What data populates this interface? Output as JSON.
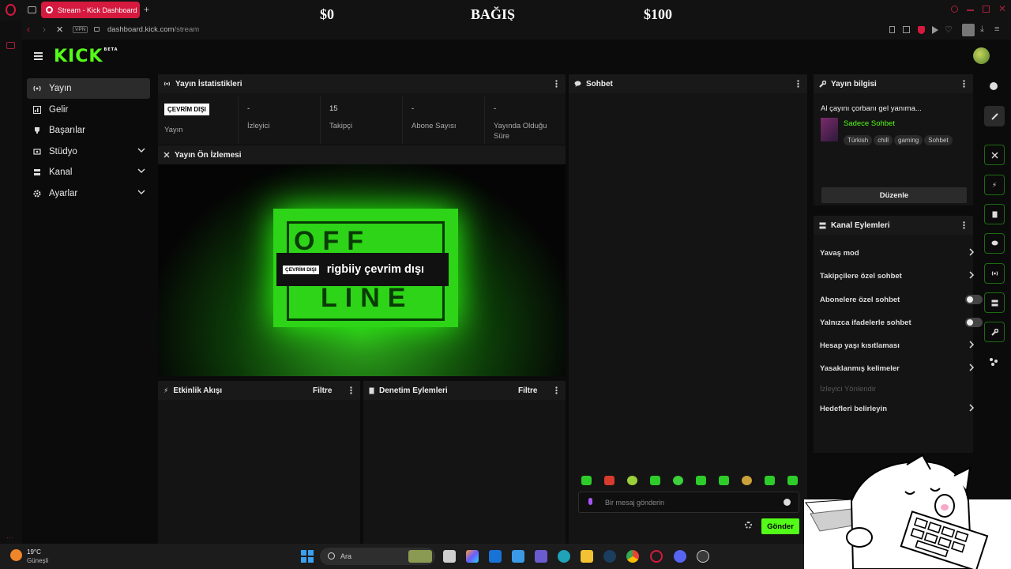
{
  "browser": {
    "tab_title": "Stream - Kick Dashboard",
    "url_host": "dashboard.kick.com",
    "url_path": "/stream",
    "vpn_label": "VPN"
  },
  "overlay": {
    "left_amount": "$0",
    "title": "BAĞIŞ",
    "right_amount": "$100"
  },
  "app": {
    "logo": "KICK",
    "logo_badge": "BETA"
  },
  "sidebar": {
    "items": [
      {
        "label": "Yayın"
      },
      {
        "label": "Gelir"
      },
      {
        "label": "Başarılar"
      },
      {
        "label": "Stüdyo"
      },
      {
        "label": "Kanal"
      },
      {
        "label": "Ayarlar"
      }
    ]
  },
  "stats_panel": {
    "title": "Yayın İstatistikleri",
    "status_badge": "ÇEVRİM DIŞI",
    "status_label": "Yayın",
    "stats": [
      {
        "value": "-",
        "label": "İzleyici"
      },
      {
        "value": "15",
        "label": "Takipçi"
      },
      {
        "value": "-",
        "label": "Abone Sayısı"
      },
      {
        "value": "-",
        "label": "Yayında Olduğu Süre"
      }
    ]
  },
  "preview_panel": {
    "title": "Yayın Ön İzlemesi",
    "sign_top": "OFF",
    "sign_bottom": "LINE",
    "offline_badge": "ÇEVRİM DIŞI",
    "offline_text": "rigbiiy çevrim dışı"
  },
  "activity_panel": {
    "title": "Etkinlik Akışı",
    "filter": "Filtre"
  },
  "moderation_panel": {
    "title": "Denetim Eylemleri",
    "filter": "Filtre"
  },
  "chat_panel": {
    "title": "Sohbet",
    "placeholder": "Bir mesaj gönderin",
    "send": "Gönder"
  },
  "info_panel": {
    "title": "Yayın bilgisi",
    "stream_title": "Al çayını çorbanı gel yanıma...",
    "category": "Sadece Sohbet",
    "tags": [
      "Türkish",
      "chill",
      "gaming",
      "Sohbet"
    ],
    "edit": "Düzenle"
  },
  "channel_actions": {
    "title": "Kanal Eylemleri",
    "rows": [
      {
        "label": "Yavaş mod",
        "control": "chevron"
      },
      {
        "label": "Takipçilere özel sohbet",
        "control": "chevron"
      },
      {
        "label": "Abonelere özel sohbet",
        "control": "toggle"
      },
      {
        "label": "Yalnızca ifadelerle sohbet",
        "control": "toggle"
      },
      {
        "label": "Hesap yaşı kısıtlaması",
        "control": "chevron"
      },
      {
        "label": "Yasaklanmış kelimeler",
        "control": "chevron"
      },
      {
        "label": "İzleyici Yönlendir",
        "control": "none"
      },
      {
        "label": "Hedefleri belirleyin",
        "control": "chevron"
      }
    ]
  },
  "taskbar": {
    "weather_temp": "19°C",
    "weather_desc": "Güneşli",
    "search": "Ara"
  },
  "colors": {
    "kick_green": "#53fc18",
    "tab_red": "#d6193e",
    "panel_bg": "#141414"
  }
}
